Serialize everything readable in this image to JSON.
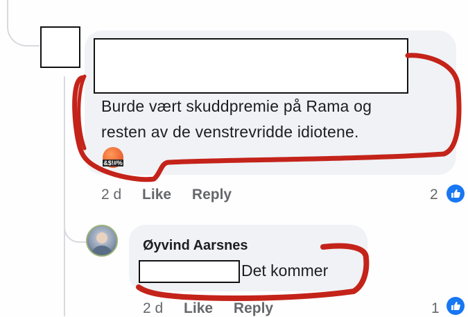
{
  "comment": {
    "text_line1": "Burde vært skuddpremie på Rama og",
    "text_line2": "resten av de venstrevridde idiotene.",
    "reaction_emoji_label": "&$!#%",
    "actions": {
      "time": "2 d",
      "like": "Like",
      "reply": "Reply"
    },
    "like_count": "2"
  },
  "reply": {
    "author": "Øyvind Aarsnes",
    "text": "Det kommer",
    "actions": {
      "time": "2 d",
      "like": "Like",
      "reply": "Reply"
    },
    "like_count": "1"
  },
  "colors": {
    "bubble": "#f0f2f5",
    "like_blue": "#1877f2",
    "annotation_red": "#c4231a"
  }
}
